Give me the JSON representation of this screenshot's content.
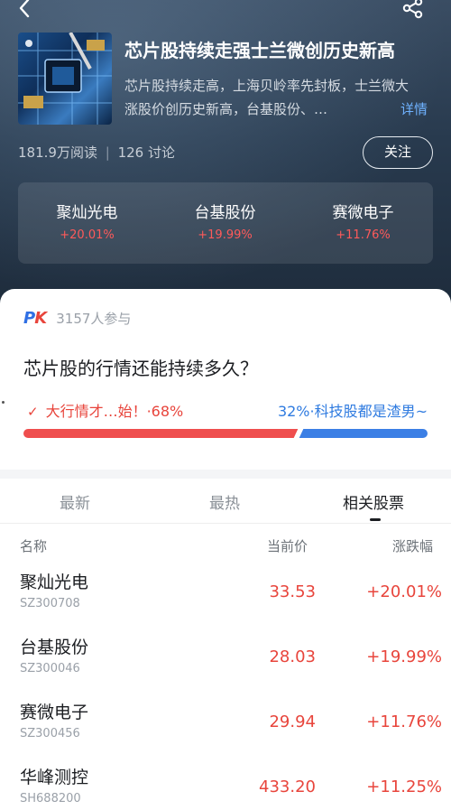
{
  "topic": {
    "title": "芯片股持续走强士兰微创历史新高",
    "description": "芯片股持续走高，上海贝岭率先封板，士兰微大涨股价创历史新高，台基股份、…",
    "detail_link": "详情",
    "reads": "181.9万阅读",
    "divider": "|",
    "discussions": "126 讨论",
    "follow_label": "关注"
  },
  "strip_stocks": [
    {
      "name": "聚灿光电",
      "change": "+20.01%"
    },
    {
      "name": "台基股份",
      "change": "+19.99%"
    },
    {
      "name": "赛微电子",
      "change": "+11.76%"
    }
  ],
  "pk": {
    "logo_p": "P",
    "logo_k": "K",
    "participants": "3157人参与",
    "question": "芯片股的行情还能持续多久？",
    "left_label": "大行情才…始！·68%",
    "right_label": "32%·科技股都是渣男~",
    "left_percent": 68,
    "right_percent": 32,
    "check_icon": "✓"
  },
  "tabs": [
    {
      "label": "最新"
    },
    {
      "label": "最热"
    },
    {
      "label": "相关股票"
    }
  ],
  "table": {
    "headers": {
      "name": "名称",
      "price": "当前价",
      "change": "涨跌幅"
    },
    "rows": [
      {
        "name": "聚灿光电",
        "code": "SZ300708",
        "price": "33.53",
        "change": "+20.01%"
      },
      {
        "name": "台基股份",
        "code": "SZ300046",
        "price": "28.03",
        "change": "+19.99%"
      },
      {
        "name": "赛微电子",
        "code": "SZ300456",
        "price": "29.94",
        "change": "+11.76%"
      },
      {
        "name": "华峰测控",
        "code": "SH688200",
        "price": "433.20",
        "change": "+11.25%"
      }
    ]
  },
  "colors": {
    "rise": "#e8453c",
    "fall_blue": "#3b7fe5",
    "link": "#6fb2ff"
  },
  "icons": {
    "back": "back-arrow-icon",
    "share": "share-icon"
  }
}
